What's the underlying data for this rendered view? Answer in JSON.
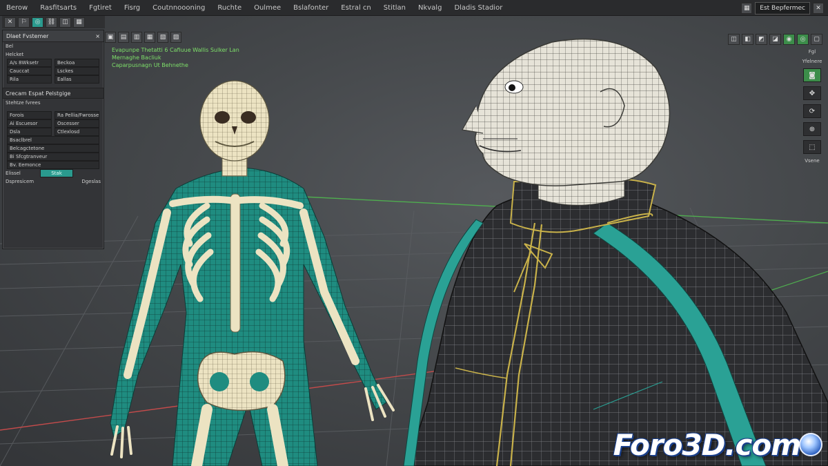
{
  "menu": {
    "items": [
      "Berow",
      "Rasfitsarts",
      "Fgtiret",
      "Fisrg",
      "Coutnnoooning",
      "Ruchte",
      "Oulmee",
      "Bslafonter",
      "Estral cn",
      "Stitlan",
      "Nkvalg",
      "Dladis Stadior"
    ],
    "right_field": "Est Bepfermec"
  },
  "left_panel": {
    "title": "Dlaet Fvstemer",
    "close": "×",
    "rows_top": [
      {
        "a": "Bel",
        "b": ""
      },
      {
        "a": "Helcket",
        "b": ""
      },
      {
        "a": "A/s 8Wksetr",
        "b": "Beckoa"
      },
      {
        "a": "Cauccat",
        "b": "Lsckes"
      },
      {
        "a": "Rila",
        "b": "Eallas"
      }
    ],
    "section1": {
      "label": "Crecam Espat",
      "value": "Pelstgige"
    },
    "section1_sub": "Stehtze fvrees",
    "rows_bottom": [
      {
        "a": "Forois",
        "b": "Ra Pellia/Fwrosseotenc"
      },
      {
        "a": "Ai Escuesor",
        "b": "Oscesser"
      },
      {
        "a": "Dsla",
        "b": "Ctlexlosd"
      },
      {
        "a": "Bsaclbrel",
        "b": ""
      },
      {
        "a": "Belcagctetone",
        "b": ""
      },
      {
        "a": "Bi Sfcgtranveur",
        "b": ""
      },
      {
        "a": "Bv. Eemonce",
        "b": ""
      }
    ],
    "slider_label": "Elissel",
    "slider_value": "Stak",
    "last_row": {
      "a": "Dspresicem",
      "b": "Dgeslas"
    }
  },
  "overlay": {
    "lines": [
      "Evapunpe Thetatti   6 Cafiuue  Wallis Sulker Lan",
      "Mernaghe Bacliuk",
      "Caparpusnagn Ut Behnethe"
    ]
  },
  "sidetools": {
    "labels": [
      "Fgl",
      "Yfelnere",
      "Vsene"
    ]
  },
  "watermark": {
    "text": "Foro3D.com"
  },
  "colors": {
    "accent": "#2a9a8e",
    "overlay_text": "#7ee06a",
    "suit_teal": "#1f8c80",
    "bone": "#ece3c2",
    "garment": "#2c2d30"
  }
}
